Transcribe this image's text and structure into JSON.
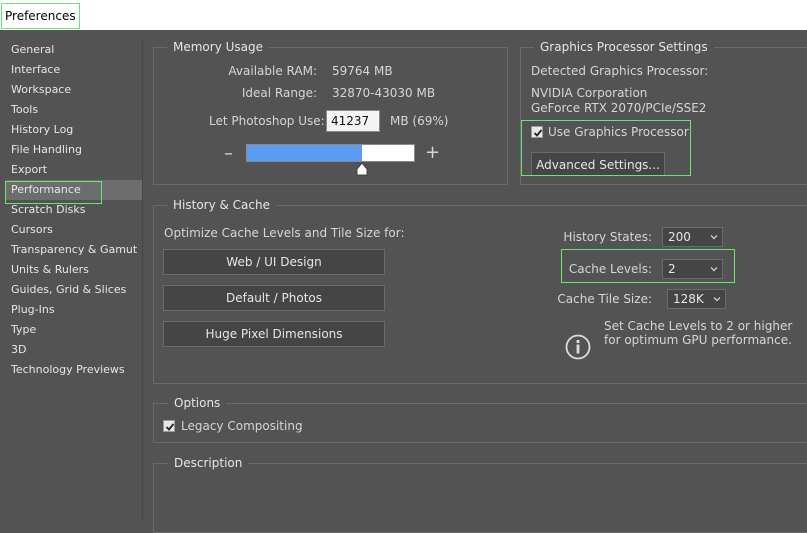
{
  "window": {
    "title": "Preferences"
  },
  "sidebar": {
    "items": [
      {
        "label": "General"
      },
      {
        "label": "Interface"
      },
      {
        "label": "Workspace"
      },
      {
        "label": "Tools"
      },
      {
        "label": "History Log"
      },
      {
        "label": "File Handling"
      },
      {
        "label": "Export"
      },
      {
        "label": "Performance"
      },
      {
        "label": "Scratch Disks"
      },
      {
        "label": "Cursors"
      },
      {
        "label": "Transparency & Gamut"
      },
      {
        "label": "Units & Rulers"
      },
      {
        "label": "Guides, Grid & Slices"
      },
      {
        "label": "Plug-Ins"
      },
      {
        "label": "Type"
      },
      {
        "label": "3D"
      },
      {
        "label": "Technology Previews"
      }
    ],
    "selected": "Performance"
  },
  "memory": {
    "title": "Memory Usage",
    "available_label": "Available RAM:",
    "available_value": "59764 MB",
    "ideal_label": "Ideal Range:",
    "ideal_value": "32870-43030 MB",
    "use_label": "Let Photoshop Use:",
    "use_value": "41237",
    "use_suffix": "MB (69%)",
    "minus": "–",
    "plus": "+",
    "slider_fraction": 0.69
  },
  "gpu": {
    "title": "Graphics Processor Settings",
    "detected_label": "Detected Graphics Processor:",
    "vendor": "NVIDIA Corporation",
    "model": "GeForce RTX 2070/PCIe/SSE2",
    "use_gpu_label": "Use Graphics Processor",
    "use_gpu_checked": true,
    "advanced_button": "Advanced Settings..."
  },
  "history": {
    "title": "History & Cache",
    "optimize_label": "Optimize Cache Levels and Tile Size for:",
    "buttons": [
      "Web / UI Design",
      "Default / Photos",
      "Huge Pixel Dimensions"
    ],
    "states_label": "History States:",
    "states_value": "200",
    "levels_label": "Cache Levels:",
    "levels_value": "2",
    "tile_label": "Cache Tile Size:",
    "tile_value": "128K",
    "info_line1": "Set Cache Levels to 2 or higher",
    "info_line2": "for optimum GPU performance."
  },
  "options": {
    "title": "Options",
    "legacy_label": "Legacy Compositing",
    "legacy_checked": true
  },
  "description": {
    "title": "Description"
  },
  "colors": {
    "highlight": "#6ee36e",
    "slider_fill": "#5b9cf0"
  }
}
